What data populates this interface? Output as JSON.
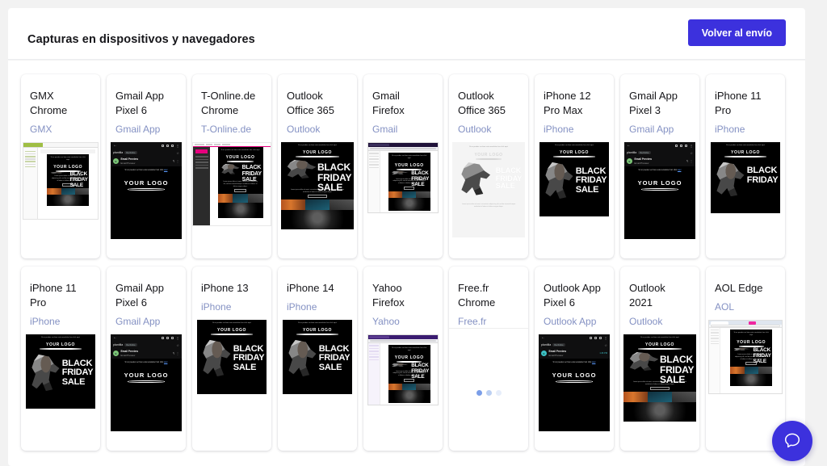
{
  "header": {
    "title": "Capturas en dispositivos y navegadores",
    "back_button_label": "Volver al envío",
    "accent_color": "#3c31dd"
  },
  "creative": {
    "preheader": "Si no puedes ver bien esta newsletter haz click aquí",
    "logo": "YOUR LOGO",
    "headline": "BLACK FRIDAY SALE",
    "body": "Lorem ipsum dolor sit amet, consectetur adipiscing elit, sed do eiusmod tempor incididunt ut labore et dolore magna aliqua.",
    "cta": "SHOP NOW"
  },
  "mobile_app": {
    "account": "plantilla",
    "account_tag": "Recibidos",
    "sender": "Email Preview",
    "subject": "Email Preview",
    "time": "1:46 PM",
    "avatar_initial": "E"
  },
  "chat": {
    "icon": "chat-bubble-icon",
    "color": "#3c31dd"
  },
  "cards": [
    {
      "title": "GMX Chrome",
      "client": "GMX",
      "thumb": "gmx"
    },
    {
      "title": "Gmail App Pixel 6",
      "client": "Gmail App",
      "thumb": "gmail-app"
    },
    {
      "title": "T-Online.de Chrome",
      "client": "T-Online.de",
      "thumb": "tonline"
    },
    {
      "title": "Outlook Office 365",
      "client": "Outlook",
      "thumb": "owa-dark"
    },
    {
      "title": "Gmail Firefox",
      "client": "Gmail",
      "thumb": "firefox"
    },
    {
      "title": "Outlook Office 365",
      "client": "Outlook",
      "thumb": "owa-light"
    },
    {
      "title": "iPhone 12 Pro Max",
      "client": "iPhone",
      "thumb": "iphone"
    },
    {
      "title": "Gmail App Pixel 3",
      "client": "Gmail App",
      "thumb": "gmail-app"
    },
    {
      "title": "iPhone 11 Pro",
      "client": "iPhone",
      "thumb": "iphone-top"
    },
    {
      "title": "iPhone 11 Pro",
      "client": "iPhone",
      "thumb": "iphone"
    },
    {
      "title": "Gmail App Pixel 6",
      "client": "Gmail App",
      "thumb": "gmail-app"
    },
    {
      "title": "iPhone 13",
      "client": "iPhone",
      "thumb": "iphone"
    },
    {
      "title": "iPhone 14",
      "client": "iPhone",
      "thumb": "iphone"
    },
    {
      "title": "Yahoo Firefox",
      "client": "Yahoo",
      "thumb": "yahoo"
    },
    {
      "title": "Free.fr Chrome",
      "client": "Free.fr",
      "thumb": "loading"
    },
    {
      "title": "Outlook App Pixel 6",
      "client": "Outlook App",
      "thumb": "outlook-app"
    },
    {
      "title": "Outlook 2021",
      "client": "Outlook",
      "thumb": "owa-dark"
    },
    {
      "title": "AOL Edge",
      "client": "AOL",
      "thumb": "edge"
    }
  ]
}
